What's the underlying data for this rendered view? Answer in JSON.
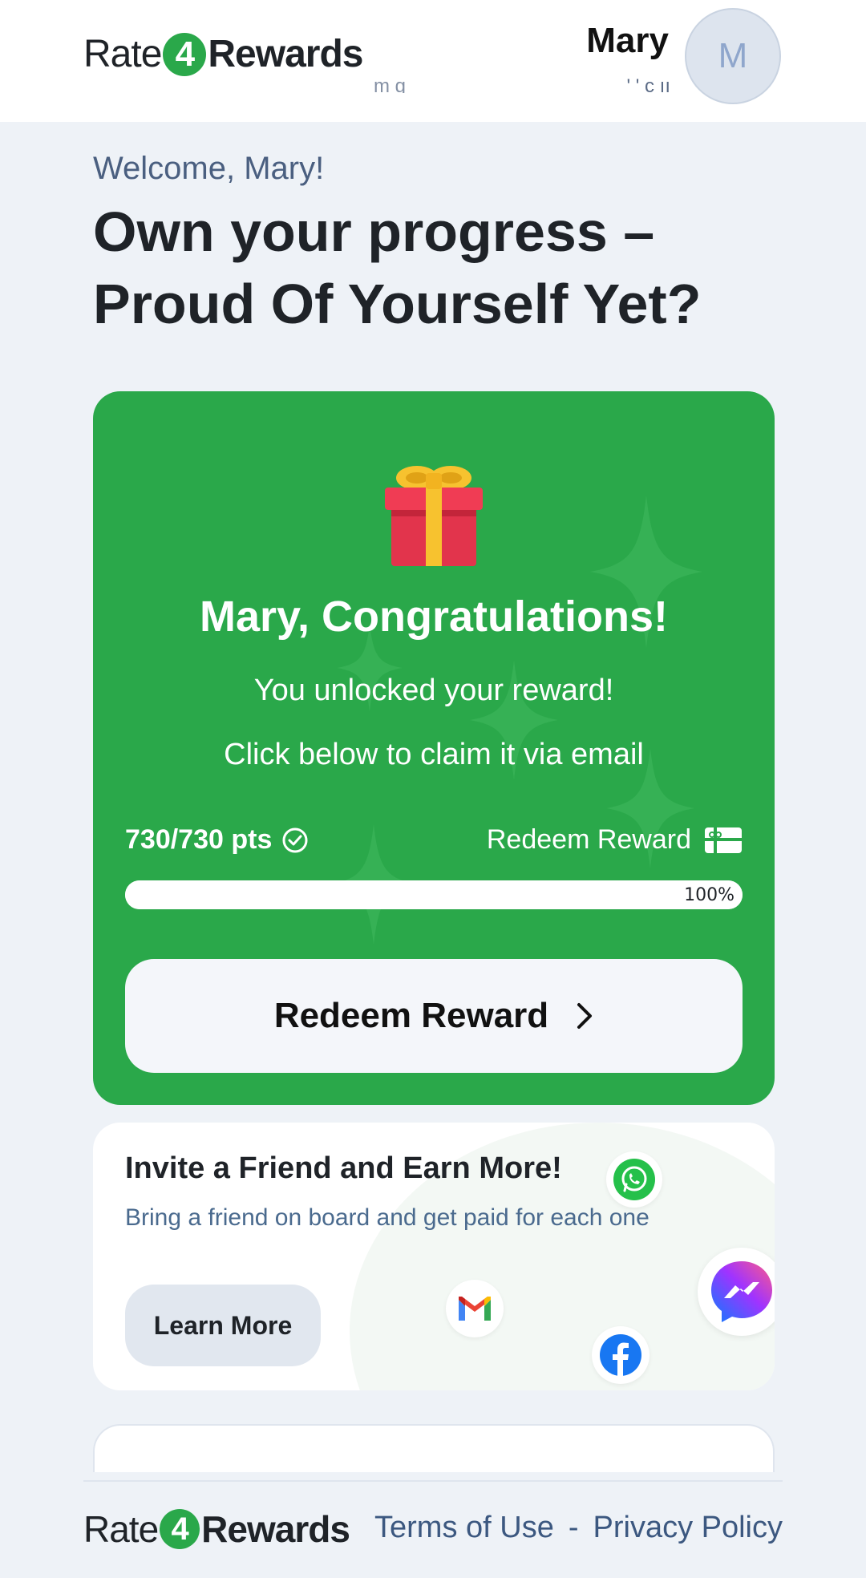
{
  "header": {
    "logo": {
      "rate": "Rate",
      "four": "4",
      "rewards": "Rewards"
    },
    "user_name": "Mary",
    "user_sub_left": "m g",
    "user_sub_right": "' ' c ıı",
    "avatar_initial": "M"
  },
  "welcome": {
    "greeting": "Welcome, Mary!",
    "headline_line1": "Own your progress –",
    "headline_line2": "Proud Of Yourself Yet?"
  },
  "reward_card": {
    "gift_icon": "gift-icon",
    "title": "Mary, Congratulations!",
    "line1": "You unlocked your reward!",
    "line2": "Click below to claim it via email",
    "points": "730/730 pts",
    "redeem_link": "Redeem Reward",
    "progress_percent": 100,
    "progress_label": "100%",
    "button_label": "Redeem Reward"
  },
  "invite_card": {
    "title": "Invite a Friend and Earn More!",
    "subtitle": "Bring a friend on board and get paid for each one",
    "button_label": "Learn More",
    "icons": [
      "whatsapp-icon",
      "gmail-icon",
      "facebook-icon",
      "messenger-icon"
    ]
  },
  "footer": {
    "logo": {
      "rate": "Rate",
      "four": "4",
      "rewards": "Rewards"
    },
    "terms": "Terms of Use",
    "separator": "-",
    "privacy": "Privacy Policy"
  },
  "colors": {
    "brand_green": "#2aa84a",
    "background": "#eef2f7",
    "text_dark": "#1f2328",
    "link_blue": "#3c5880"
  }
}
